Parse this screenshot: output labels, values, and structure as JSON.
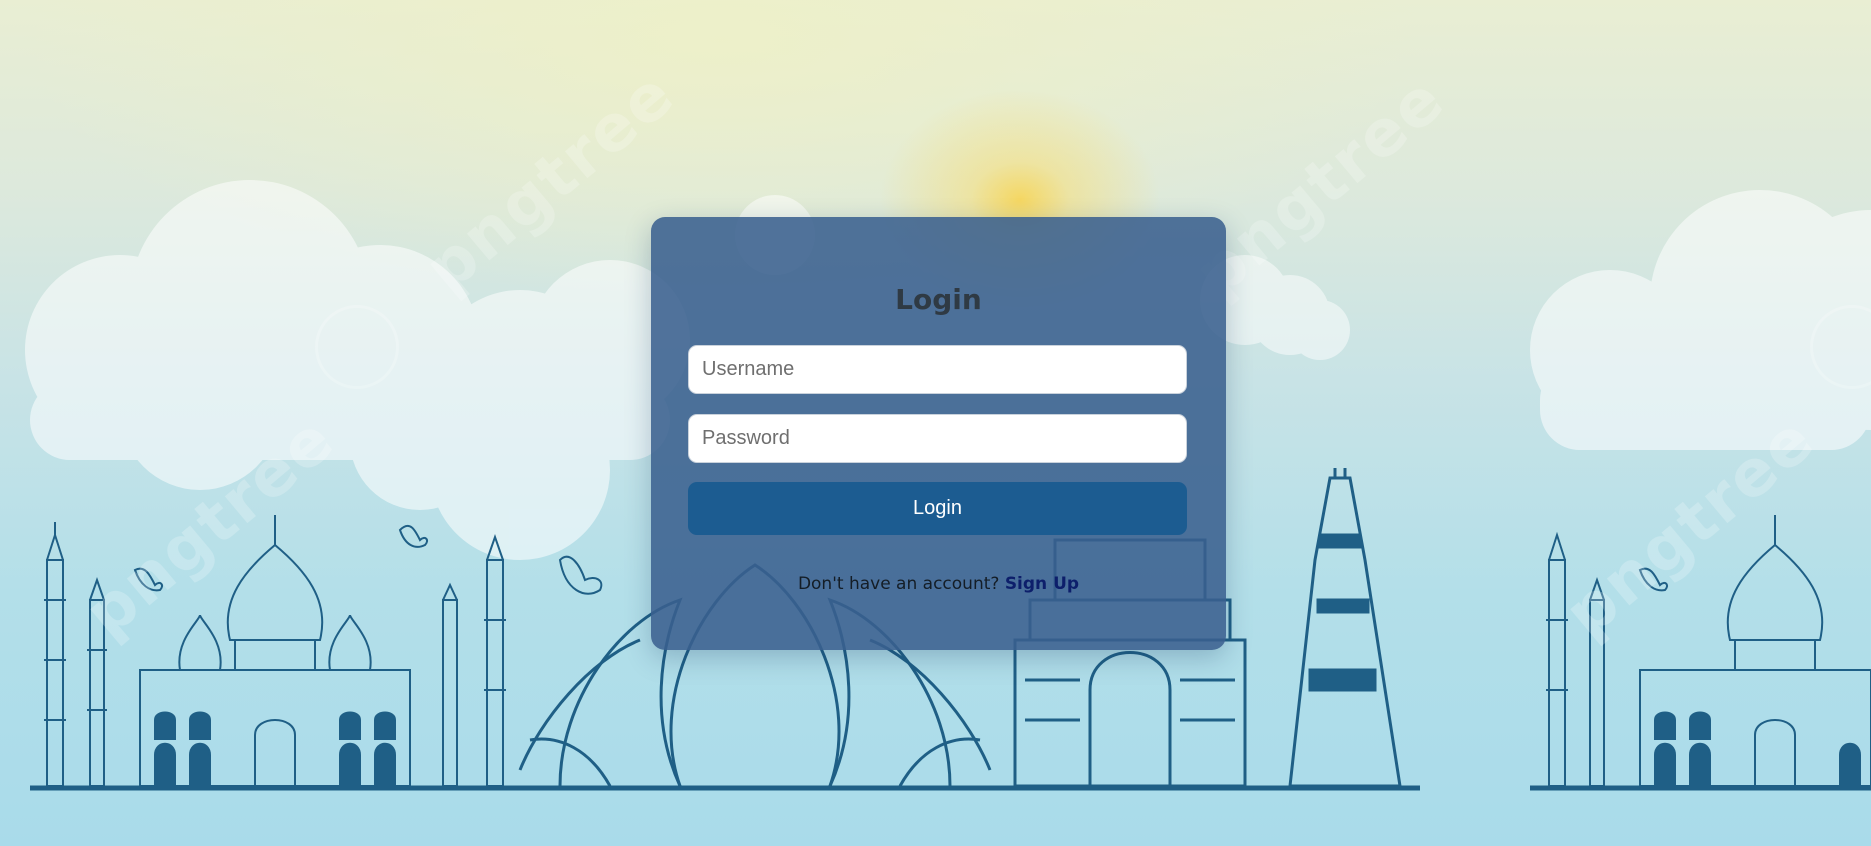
{
  "login": {
    "title": "Login",
    "username_placeholder": "Username",
    "password_placeholder": "Password",
    "submit_label": "Login",
    "signup_prompt": "Don't have an account?",
    "signup_link": "Sign Up"
  },
  "watermark": {
    "text": "pngtree"
  },
  "colors": {
    "card_background": "#3a608e",
    "button_background": "#1c5c91",
    "signup_link": "#0d1f6b",
    "title_text": "#2f3a44",
    "monument_ink": "#1f5f86",
    "sun": "#f6d65c"
  },
  "icons": {
    "background": [
      "cloud-icon",
      "taj-mahal-icon",
      "lotus-temple-icon",
      "india-gate-icon",
      "qutub-minar-icon",
      "dove-icon",
      "sun-icon"
    ]
  }
}
